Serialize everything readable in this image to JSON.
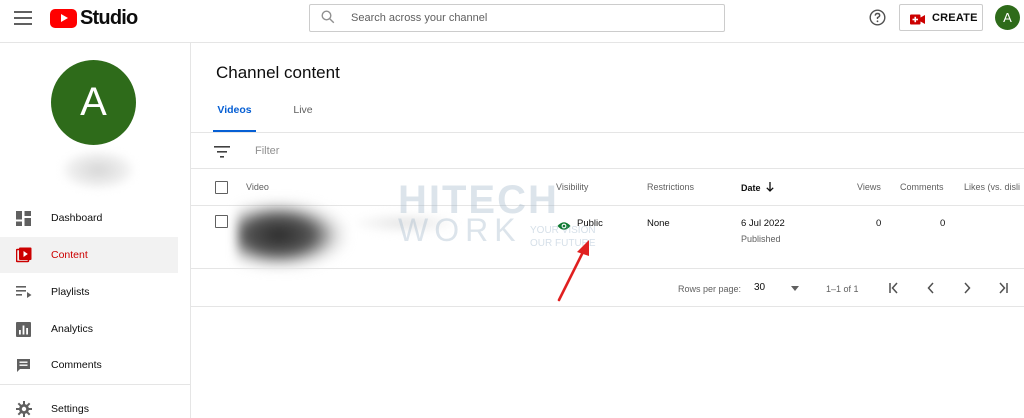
{
  "header": {
    "logo_text": "Studio",
    "search_placeholder": "Search across your channel",
    "create_label": "CREATE",
    "avatar_letter": "A"
  },
  "sidebar": {
    "avatar_letter": "A",
    "items": [
      {
        "label": "Dashboard",
        "icon": "dashboard-icon",
        "active": false
      },
      {
        "label": "Content",
        "icon": "content-icon",
        "active": true
      },
      {
        "label": "Playlists",
        "icon": "playlists-icon",
        "active": false
      },
      {
        "label": "Analytics",
        "icon": "analytics-icon",
        "active": false
      },
      {
        "label": "Comments",
        "icon": "comments-icon",
        "active": false
      },
      {
        "label": "Settings",
        "icon": "settings-icon",
        "active": false
      }
    ]
  },
  "main": {
    "title": "Channel content",
    "tabs": [
      {
        "label": "Videos",
        "active": true
      },
      {
        "label": "Live",
        "active": false
      }
    ],
    "filter_placeholder": "Filter",
    "columns": {
      "video": "Video",
      "visibility": "Visibility",
      "restrictions": "Restrictions",
      "date": "Date",
      "views": "Views",
      "comments": "Comments",
      "likes": "Likes (vs. disli"
    },
    "rows": [
      {
        "visibility": "Public",
        "restrictions": "None",
        "date": "6 Jul 2022",
        "date_status": "Published",
        "views": "0",
        "comments": "0"
      }
    ],
    "pagination": {
      "rows_per_page_label": "Rows per page:",
      "rows_per_page_value": "30",
      "range": "1–1 of 1"
    }
  },
  "watermark": {
    "line1": "HITECH",
    "line2": "WORK",
    "tagline1": "YOUR VISION",
    "tagline2": "OUR FUTURE"
  },
  "colors": {
    "brand_red": "#ff0000",
    "active_red": "#cc0000",
    "link_blue": "#065fd4",
    "avatar_green": "#2e6b1a",
    "public_green": "#0f7b32",
    "arrow_red": "#e02020"
  }
}
